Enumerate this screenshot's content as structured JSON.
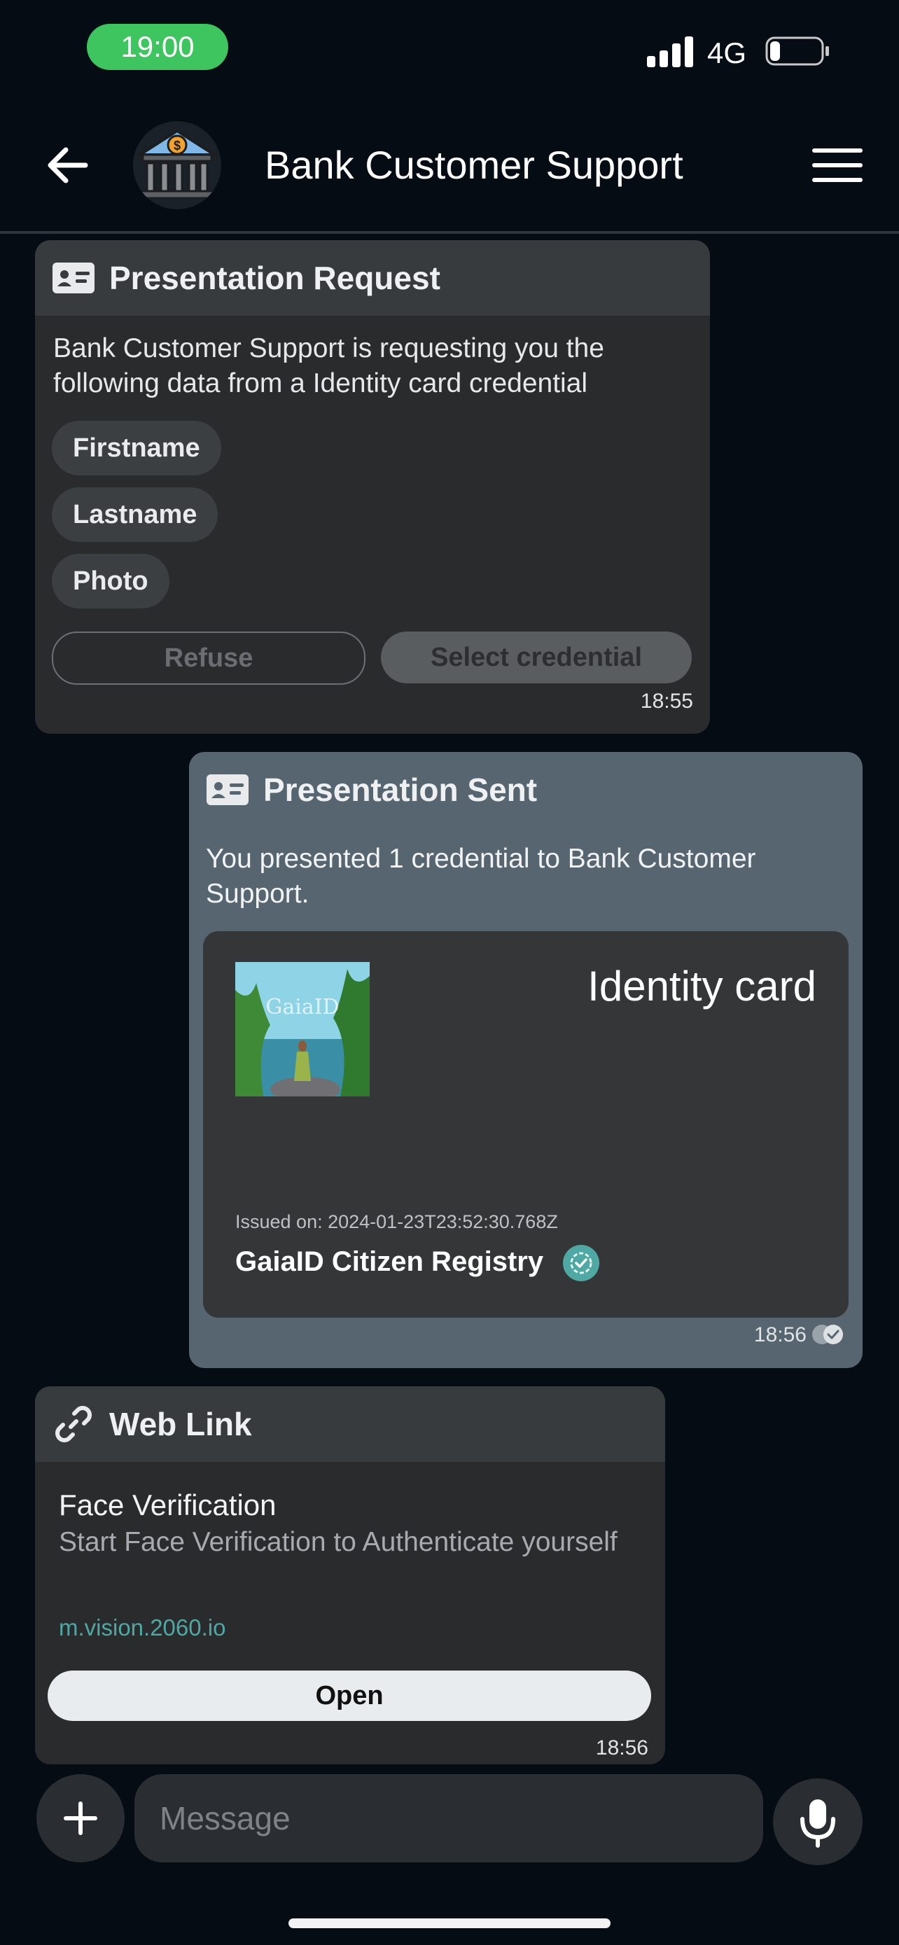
{
  "status_bar": {
    "time": "19:00",
    "network": "4G",
    "signal_bars": 4,
    "battery_level": 0.2
  },
  "header": {
    "title": "Bank Customer Support",
    "avatar": "bank-icon",
    "back_icon": "arrow-left-icon",
    "menu_icon": "hamburger-menu-icon"
  },
  "messages": {
    "presentation_request": {
      "title": "Presentation Request",
      "icon": "id-card-icon",
      "text": "Bank Customer Support is requesting you the following data from a Identity card credential",
      "fields": [
        "Firstname",
        "Lastname",
        "Photo"
      ],
      "refuse_label": "Refuse",
      "select_label": "Select credential",
      "time": "18:55"
    },
    "presentation_sent": {
      "title": "Presentation Sent",
      "icon": "id-card-icon",
      "text": "You presented 1 credential to Bank Customer Support.",
      "credential": {
        "thumb_text": "GaiaID",
        "title": "Identity card",
        "issued": "Issued on: 2024-01-23T23:52:30.768Z",
        "issuer": "GaiaID Citizen Registry",
        "verified_icon": "verified-badge-icon"
      },
      "time": "18:56",
      "status_icon": "double-check-icon"
    },
    "web_link": {
      "title": "Web Link",
      "icon": "link-icon",
      "link_title": "Face Verification",
      "description": "Start Face Verification to Authenticate yourself",
      "url": "m.vision.2060.io",
      "open_label": "Open",
      "time": "18:56"
    }
  },
  "composer": {
    "placeholder": "Message",
    "plus_icon": "plus-icon",
    "mic_icon": "microphone-icon"
  },
  "colors": {
    "status_green": "#3ec55f",
    "background": "#050c13",
    "sent_bubble": "#566570",
    "link_url": "#4fa8a4"
  }
}
